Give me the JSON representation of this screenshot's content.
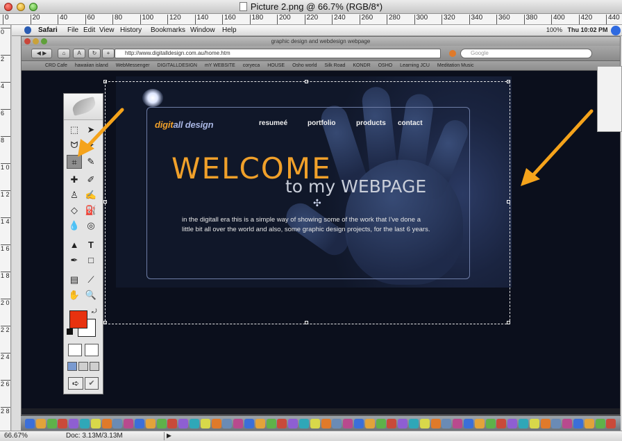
{
  "photoshop": {
    "doc_title": "Picture 2.png @ 66.7% (RGB/8*)",
    "zoom": "66.67%",
    "doc_size": "Doc: 3.13M/3.13M",
    "ruler_top": [
      "0",
      "20",
      "40",
      "60",
      "80",
      "100",
      "120",
      "140",
      "160",
      "180",
      "200",
      "220",
      "240",
      "260",
      "280",
      "300",
      "320",
      "340",
      "360",
      "380",
      "400",
      "420",
      "440"
    ],
    "ruler_left": [
      "0",
      "2",
      "4",
      "6",
      "8",
      "1 0",
      "1 2",
      "1 4",
      "1 6",
      "1 8",
      "2 0",
      "2 2",
      "2 4",
      "2 6",
      "2 8"
    ],
    "foreground_color": "#e8320f",
    "background_color": "#ffffff"
  },
  "mac_menubar": {
    "app": "Safari",
    "items": [
      "File",
      "Edit",
      "View",
      "History",
      "Bookmarks",
      "Window",
      "Help"
    ],
    "status": "100%",
    "clock": "Thu 10:02 PM"
  },
  "safari": {
    "window_title": "graphic design and webdesign webpage",
    "address": "http://www.digitalldesign.com.au/home.htm",
    "search_placeholder": "Google",
    "bookmarks": [
      "CRD Cafe",
      "hawaiian island",
      "WebMessenger",
      "DIGITALLDESIGN",
      "mY WEBSITE",
      "coryeca",
      "HOUSE",
      "Osho world",
      "Silk Road",
      "KONDR",
      "OSHO",
      "Learning JCU",
      "Meditation Music"
    ]
  },
  "website": {
    "logo_accent": "digit",
    "logo_rest": "all design",
    "nav": [
      "resumeé",
      "portfolio",
      "products",
      "contact"
    ],
    "headline": "WELCOME",
    "subheadline": "to my WEBPAGE",
    "intro": "in the digitall era this is a simple way of showing some of the work that I've done a little bit all over the world and also, some graphic design projects, for the last 6 years."
  },
  "colors": {
    "accent": "#f0a02a",
    "annotation_arrow": "#f5a31b",
    "page_background": "#0b0f1c"
  }
}
